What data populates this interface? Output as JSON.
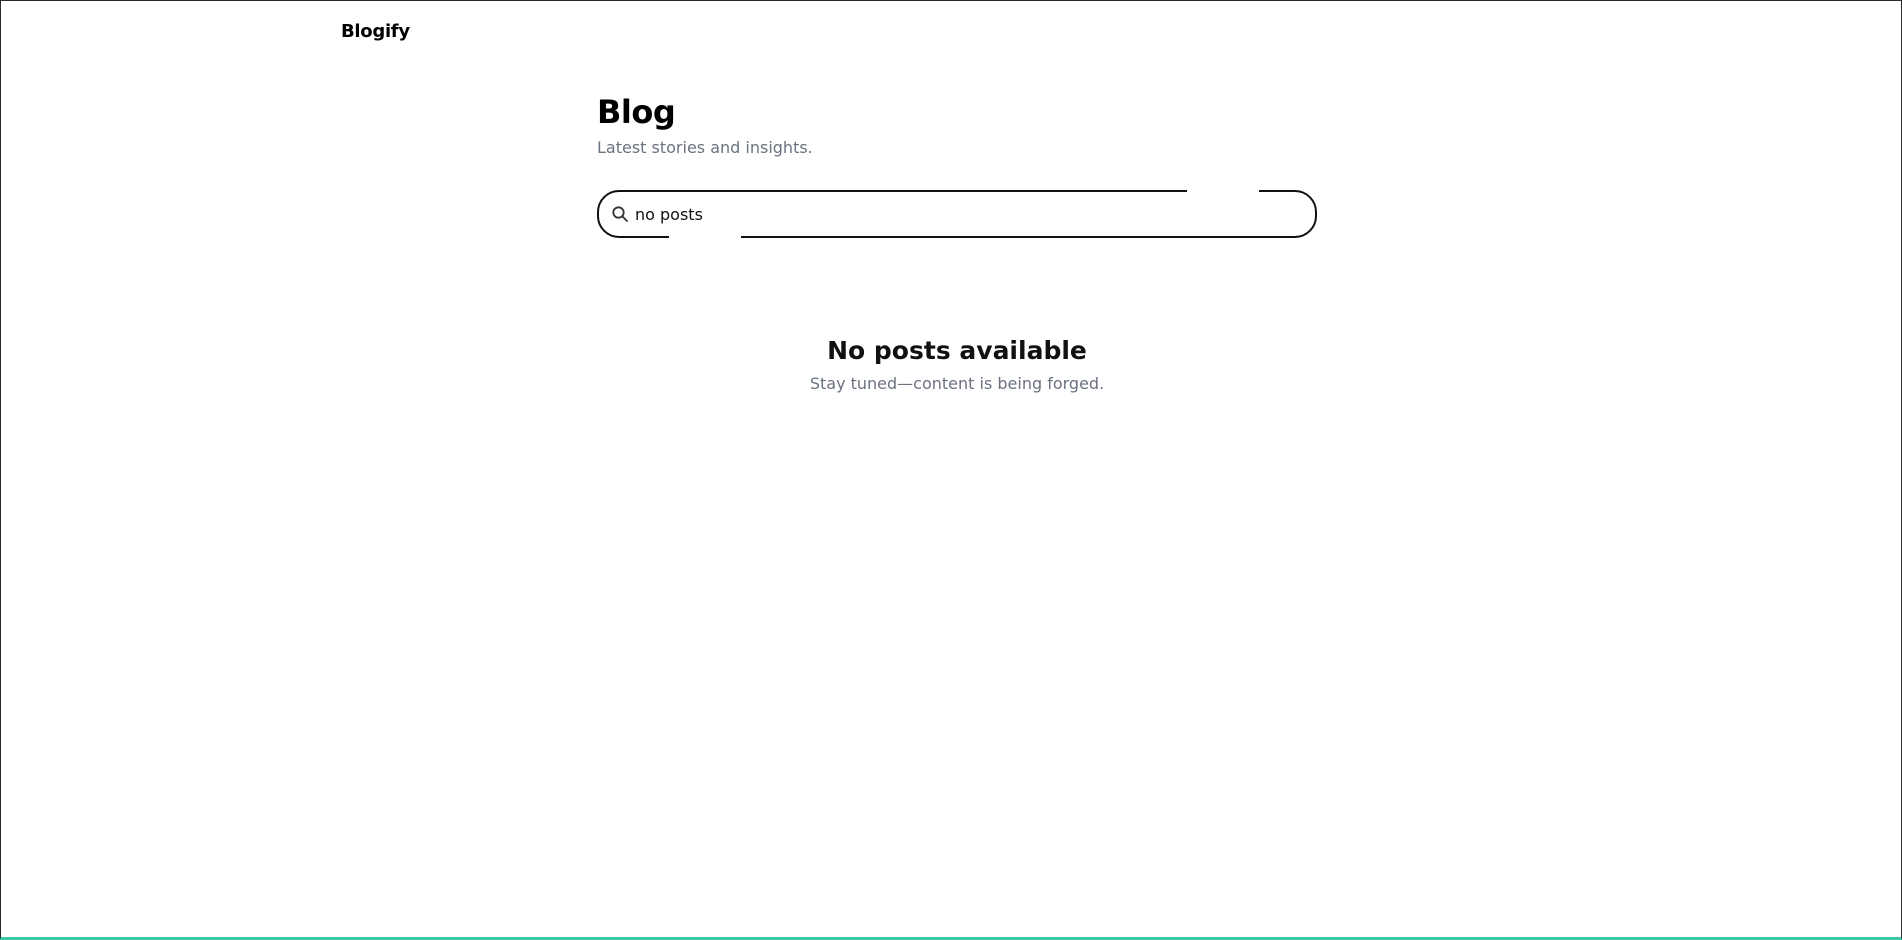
{
  "header": {
    "brand": "Blogify"
  },
  "main": {
    "title": "Blog",
    "subtitle": "Latest stories and insights."
  },
  "search": {
    "value": "no posts",
    "icon": "search-icon"
  },
  "empty_state": {
    "title": "No posts available",
    "message": "Stay tuned—content is being forged."
  },
  "colors": {
    "border": "#111111",
    "muted_text": "#6b7280",
    "accent_bottom": "#3cc7a6"
  }
}
